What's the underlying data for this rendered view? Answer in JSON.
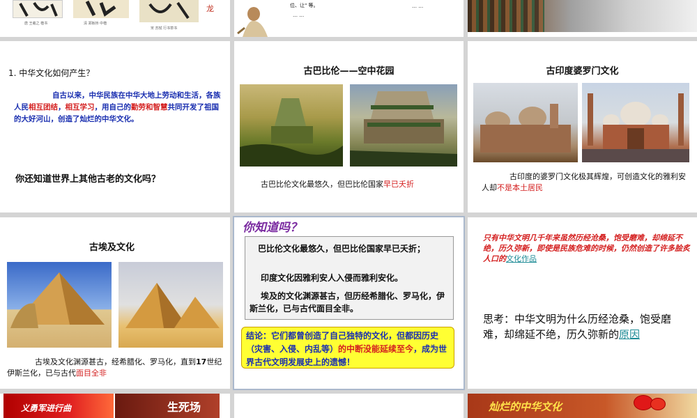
{
  "top_row": {
    "s1_caption1": "唐 王羲之 楷书",
    "s1_caption2": "清 郑板桥 中楷",
    "s1_caption3": "宋 苏轼 行书草书",
    "s2_line1": "位、让\" 等。",
    "s2_ellipsis1": "… …",
    "s2_ellipsis2": "… …"
  },
  "slide_a": {
    "question": "1. 中华文化如何产生？",
    "para_p1": "自古以来，中华民族在中华大地上劳动和生活，各族人民",
    "para_r1": "相互团结",
    "para_p2": "，",
    "para_r2": "相互学习",
    "para_p3": "，用自己的",
    "para_r3": "勤劳和智慧",
    "para_p4": "共同开发了祖国的大好河山，创造了灿烂的中华文化。",
    "bottom_q": "你还知道世界上其他古老的文化吗？"
  },
  "slide_b": {
    "title": "古巴比伦——空中花园",
    "caption_p": "古巴比伦文化最悠久，但巴比伦国家",
    "caption_r": "早已夭折"
  },
  "slide_c": {
    "title": "古印度婆罗门文化",
    "caption_p": "古印度的婆罗门文化极其辉煌，可创造文化的雅利安人却",
    "caption_r": "不是本土居民"
  },
  "slide_d": {
    "title": "古埃及文化",
    "caption_p1": "古埃及文化渊源甚古，经希腊化、罗马化，直到",
    "caption_num": "17",
    "caption_p2": "世纪伊斯兰化，已与古代",
    "caption_r": "面目全非"
  },
  "slide_e": {
    "heading": "你知道吗？",
    "line1": "巴比伦文化最悠久，但巴比伦国家早已夭折；",
    "line2": "印度文化因雅利安人入侵而雅利安化。",
    "line3": "埃及的文化渊源甚古，但历经希腊化、罗马化，伊斯兰化，已与古代面目全非。",
    "conc_p1": "结论：它们都曾创造了自己独特的文化，但都因历史（灾害、入侵、内乱等）",
    "conc_r": "的中断没能延续至今",
    "conc_p2": "，成为世界古代文明发展史上的遗憾！"
  },
  "slide_f": {
    "top_text": "只有中华文明几千年来虽然历经沧桑，饱受磨难，却绵延不绝，历久弥新，即使是民族危难的时候，仍然创造了许多脍炙人口的",
    "top_link": "文化作品",
    "think_text": "思考：中华文明为什么历经沧桑，饱受磨难，却绵延不绝，历久弥新的",
    "think_link": "原因"
  },
  "bottom_row": {
    "s1_left": "义勇军进行曲",
    "s1_right": "生死场",
    "s3_title": "灿烂的中华文化"
  },
  "colors": {
    "red": "#d42020",
    "blue": "#1a2fb0",
    "teal_link": "#1d8b96",
    "conclusion_bg": "#ffff33",
    "heading_purple": "#7a2aa0"
  }
}
